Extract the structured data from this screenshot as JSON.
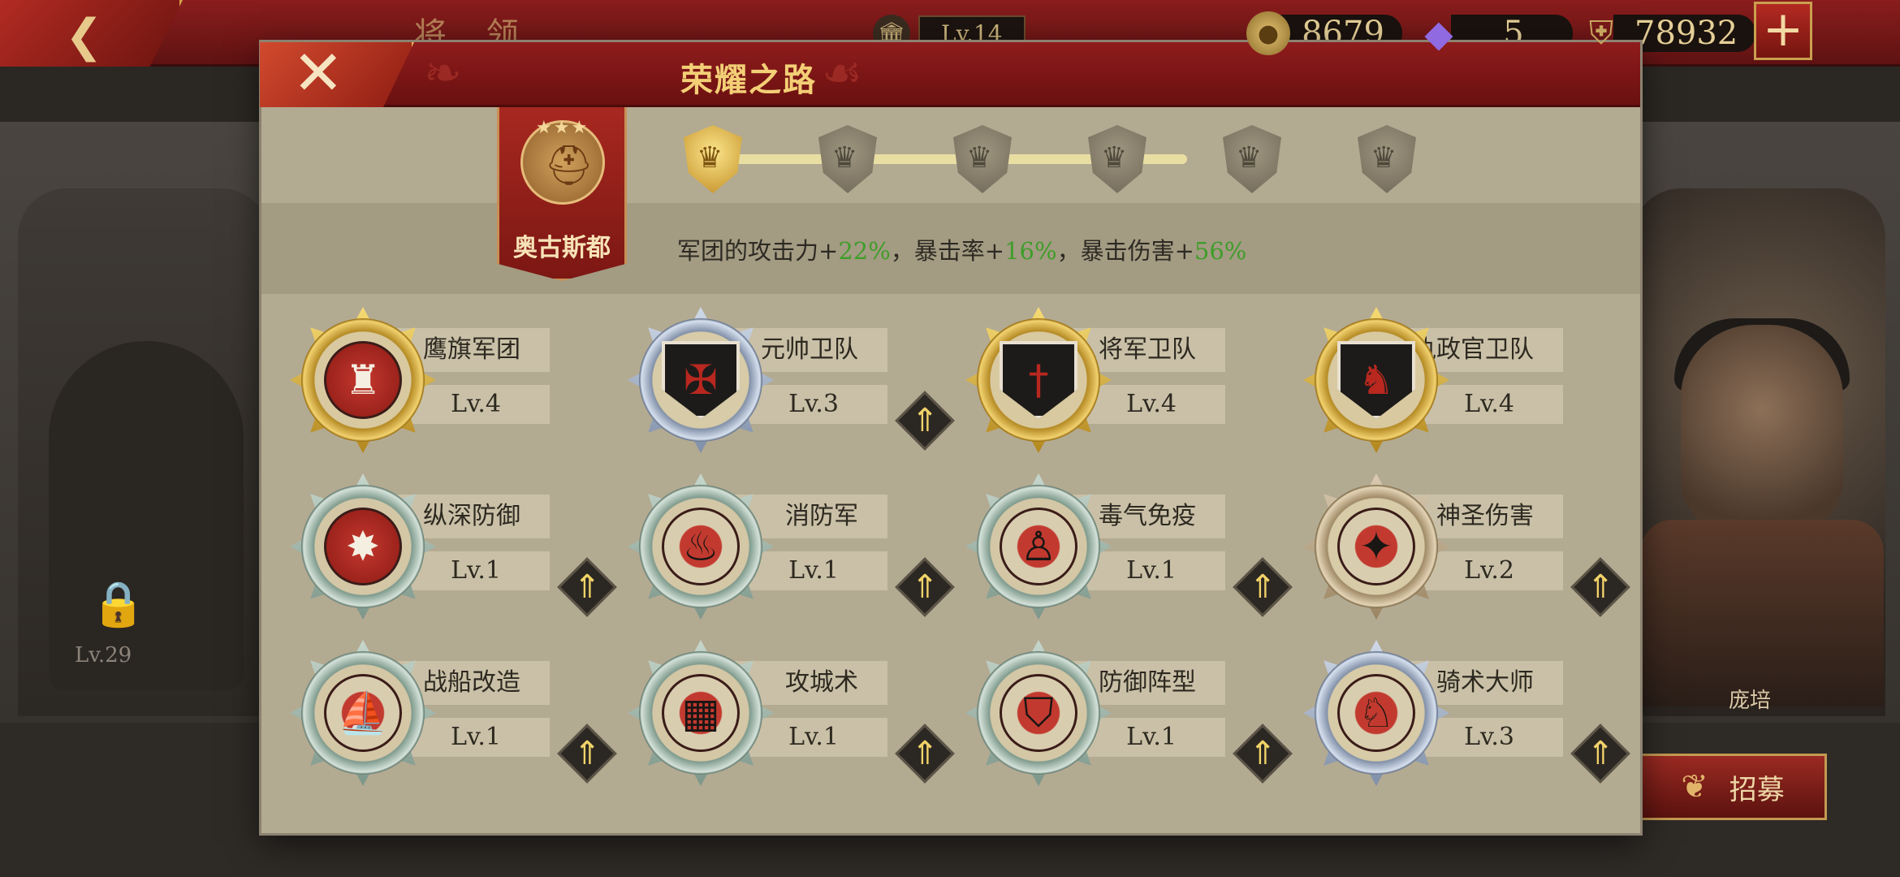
{
  "background": {
    "back_icon": "chevron-left-icon",
    "screen_title": "将 领",
    "city_level": "Lv.14",
    "resources": {
      "gold": "8679",
      "gems": "5",
      "power": "78932"
    },
    "plus_label": "+",
    "locked_level": "Lv.29",
    "hero_name": "庞培",
    "recruit_label": "招募"
  },
  "modal": {
    "title": "荣耀之路",
    "close_label": "✕",
    "rank": {
      "name": "奥古斯都",
      "nodes": [
        {
          "state": "active"
        },
        {
          "state": "inactive"
        },
        {
          "state": "inactive"
        },
        {
          "state": "inactive"
        },
        {
          "state": "inactive"
        },
        {
          "state": "inactive"
        }
      ]
    },
    "bonus": {
      "prefix": "军团的攻击力+",
      "attack": "22%",
      "crit_rate_label": "，暴击率+",
      "crit_rate": "16%",
      "crit_dmg_label": "，暴击伤害+",
      "crit_dmg": "56%"
    },
    "skills": [
      {
        "name": "鹰旗军团",
        "level": "Lv.4",
        "frame": "gold",
        "icon": "eagle-banner-icon",
        "upgrade": false
      },
      {
        "name": "元帅卫队",
        "level": "Lv.3",
        "frame": "silver",
        "icon": "marshal-shield-icon",
        "upgrade": true
      },
      {
        "name": "将军卫队",
        "level": "Lv.4",
        "frame": "gold",
        "icon": "general-shield-icon",
        "upgrade": false
      },
      {
        "name": "执政官卫队",
        "level": "Lv.4",
        "frame": "gold",
        "icon": "consul-horse-shield-icon",
        "upgrade": false
      },
      {
        "name": "纵深防御",
        "level": "Lv.1",
        "frame": "teal",
        "icon": "shield-wall-icon",
        "upgrade": true
      },
      {
        "name": "消防军",
        "level": "Lv.1",
        "frame": "teal",
        "icon": "fire-hammer-icon",
        "upgrade": true
      },
      {
        "name": "毒气免疫",
        "level": "Lv.1",
        "frame": "teal",
        "icon": "strongman-icon",
        "upgrade": true
      },
      {
        "name": "神圣伤害",
        "level": "Lv.2",
        "frame": "bronze",
        "icon": "holy-star-icon",
        "upgrade": true
      },
      {
        "name": "战船改造",
        "level": "Lv.1",
        "frame": "teal",
        "icon": "warship-gear-icon",
        "upgrade": true
      },
      {
        "name": "攻城术",
        "level": "Lv.1",
        "frame": "teal",
        "icon": "siege-wall-icon",
        "upgrade": true
      },
      {
        "name": "防御阵型",
        "level": "Lv.1",
        "frame": "teal",
        "icon": "defense-formation-icon",
        "upgrade": true
      },
      {
        "name": "骑术大师",
        "level": "Lv.3",
        "frame": "silver",
        "icon": "horse-master-icon",
        "upgrade": true
      }
    ]
  }
}
